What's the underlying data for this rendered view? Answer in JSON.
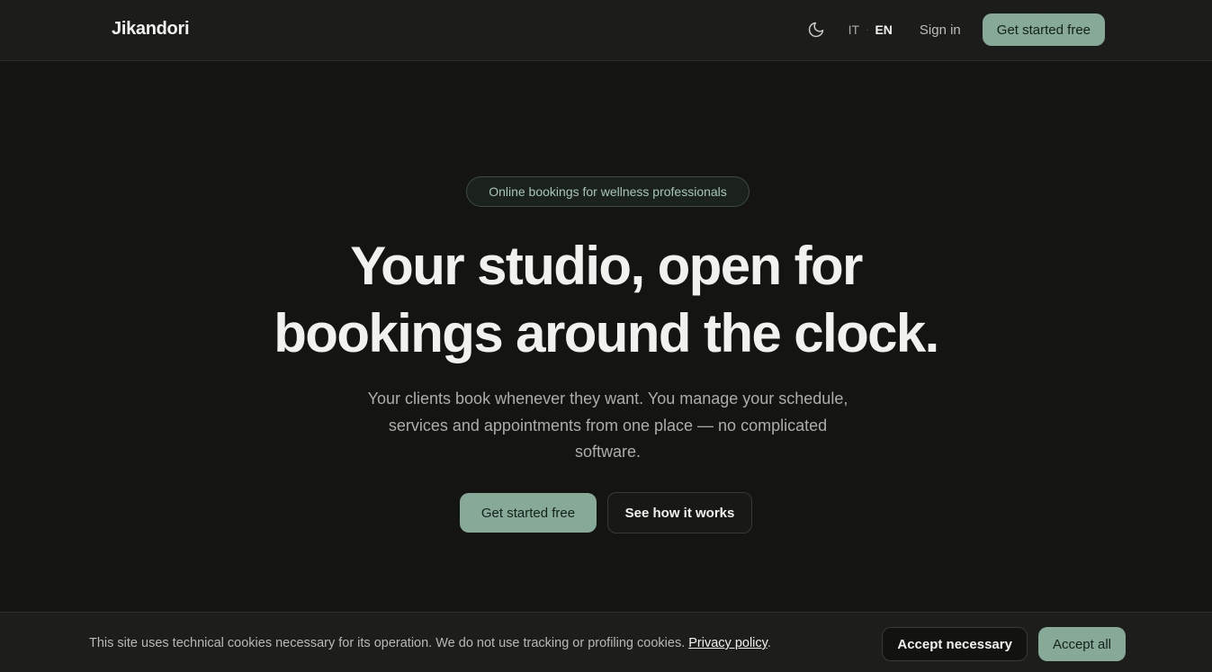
{
  "header": {
    "logo": "Jikandori",
    "theme_icon": "moon-icon",
    "lang_it": "IT",
    "lang_separator": "·",
    "lang_en": "EN",
    "sign_in": "Sign in",
    "cta": "Get started free"
  },
  "hero": {
    "badge": "Online bookings for wellness professionals",
    "headline_line1": "Your studio, open for",
    "headline_line2": "bookings around the clock.",
    "subtitle": "Your clients book whenever they want. You manage your schedule, services and appointments from one place — no complicated software.",
    "primary_cta": "Get started free",
    "secondary_cta": "See how it works"
  },
  "cookie_banner": {
    "text": "This site uses technical cookies necessary for its operation. We do not use tracking or profiling cookies.",
    "policy_link": "Privacy policy",
    "suffix": ".",
    "accept_necessary": "Accept necessary",
    "accept_all": "Accept all"
  },
  "colors": {
    "background": "#141413",
    "accent": "#87aa98",
    "badge_text": "#a6c6b5"
  }
}
